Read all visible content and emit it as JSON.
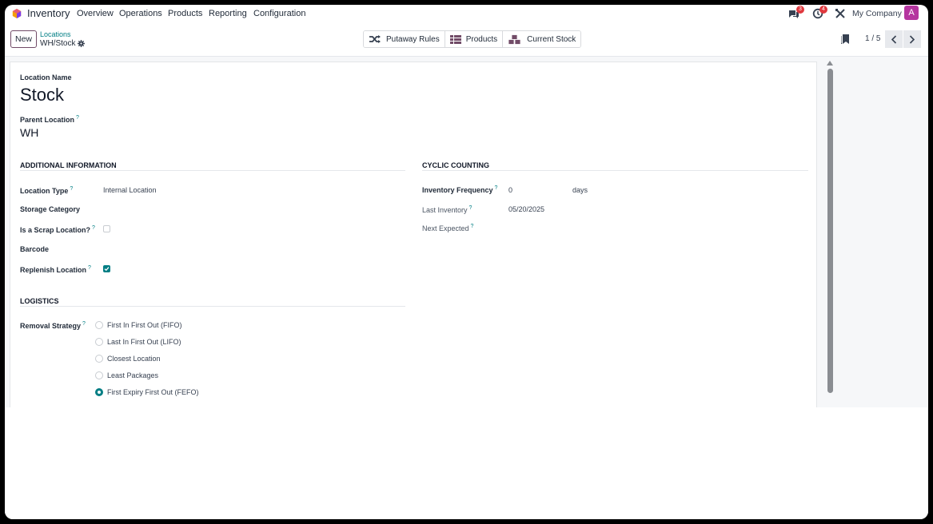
{
  "navbar": {
    "app_name": "Inventory",
    "menus": [
      "Overview",
      "Operations",
      "Products",
      "Reporting",
      "Configuration"
    ],
    "messages_count": "3",
    "activities_count": "4",
    "company": "My Company",
    "avatar_letter": "A"
  },
  "control_panel": {
    "new_label": "New",
    "breadcrumb_parent": "Locations",
    "breadcrumb_current": "WH/Stock",
    "smart_buttons": [
      "Putaway Rules",
      "Products",
      "Current Stock"
    ],
    "pager": "1 / 5"
  },
  "form": {
    "location_name_label": "Location Name",
    "location_name": "Stock",
    "parent_location_label": "Parent Location",
    "parent_location": "WH",
    "additional_info": {
      "title": "ADDITIONAL INFORMATION",
      "location_type_label": "Location Type",
      "location_type": "Internal Location",
      "storage_category_label": "Storage Category",
      "scrap_label": "Is a Scrap Location?",
      "scrap_checked": false,
      "barcode_label": "Barcode",
      "replenish_label": "Replenish Location",
      "replenish_checked": true
    },
    "cyclic_counting": {
      "title": "CYCLIC COUNTING",
      "frequency_label": "Inventory Frequency",
      "frequency_value": "0",
      "frequency_unit": "days",
      "last_inventory_label": "Last Inventory",
      "last_inventory": "05/20/2025",
      "next_expected_label": "Next Expected"
    },
    "logistics": {
      "title": "LOGISTICS",
      "removal_label": "Removal Strategy",
      "options": [
        "First In First Out (FIFO)",
        "Last In First Out (LIFO)",
        "Closest Location",
        "Least Packages",
        "First Expiry First Out (FEFO)"
      ],
      "selected": "First Expiry First Out (FEFO)"
    },
    "help_mark": "?"
  },
  "colors": {
    "accent": "#017e84",
    "brand": "#714b67",
    "avatar": "#b5359f",
    "badge": "#e0383e"
  }
}
